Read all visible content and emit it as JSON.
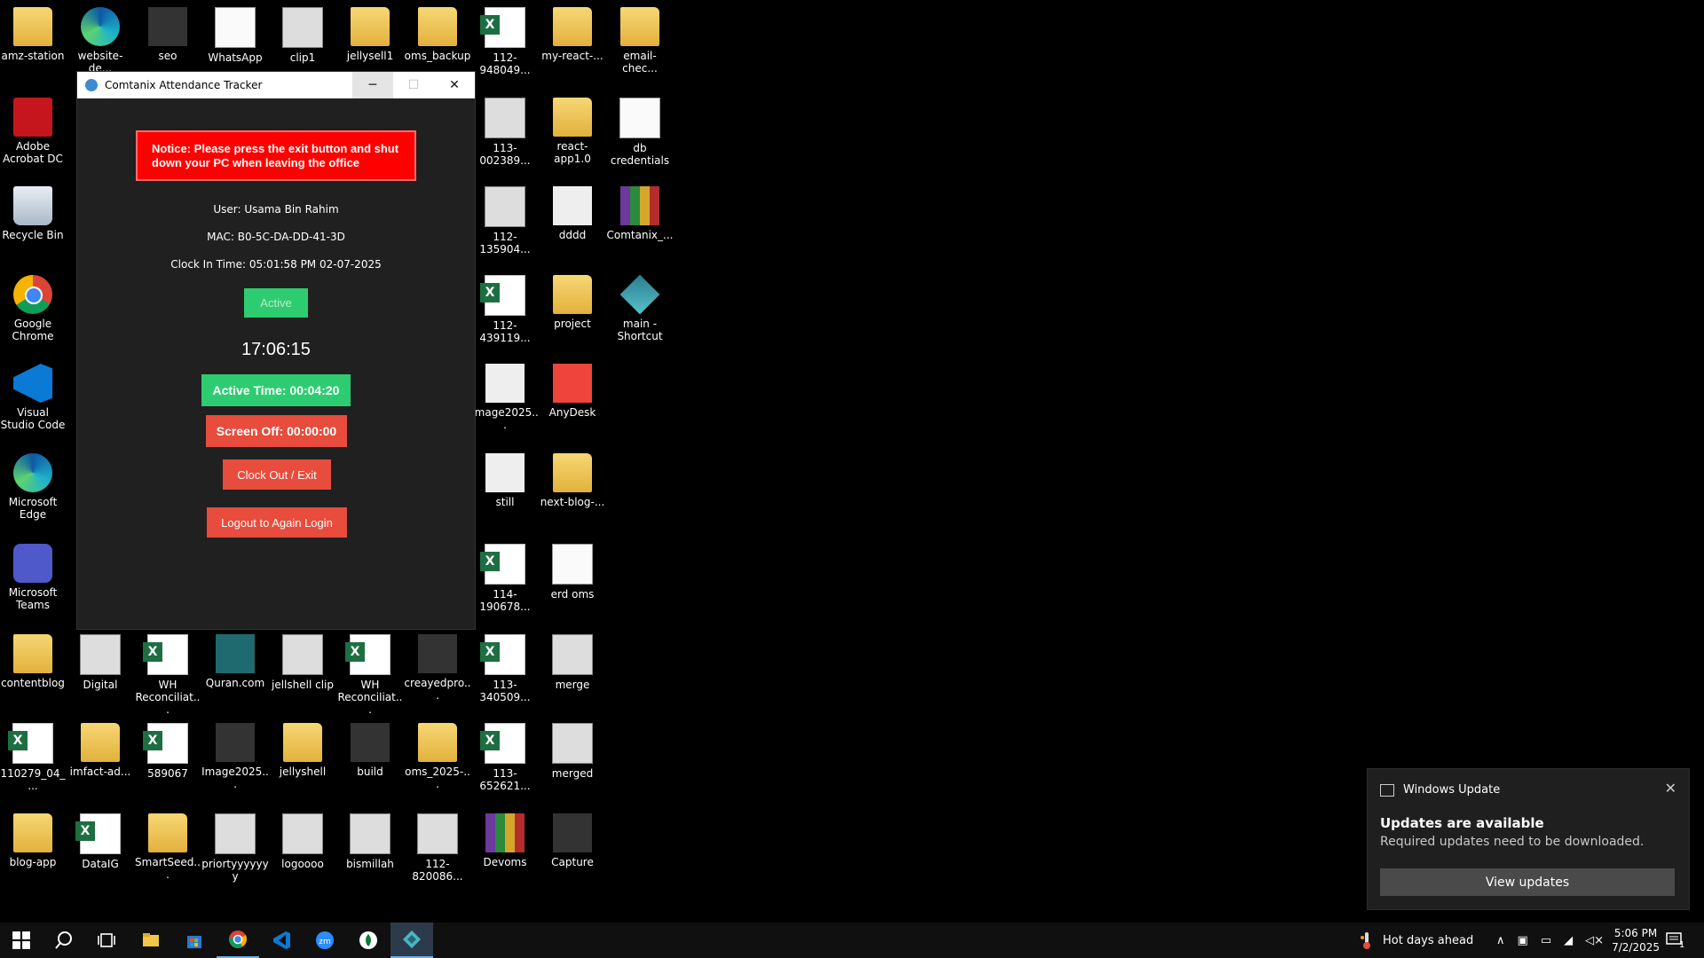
{
  "desktop": {
    "icons": [
      {
        "label": "amz-station"
      },
      {
        "label": "website-de..."
      },
      {
        "label": "seo"
      },
      {
        "label": "WhatsApp"
      },
      {
        "label": "clip1"
      },
      {
        "label": "jellysell1"
      },
      {
        "label": "oms_backup"
      },
      {
        "label": "112-948049..."
      },
      {
        "label": "my-react-..."
      },
      {
        "label": "email-chec..."
      },
      {
        "label": "Adobe Acrobat DC"
      },
      {
        "label": "113-002389..."
      },
      {
        "label": "react-app1.0"
      },
      {
        "label": "db credentials"
      },
      {
        "label": "Recycle Bin"
      },
      {
        "label": "112-135904..."
      },
      {
        "label": "dddd"
      },
      {
        "label": "Comtanix_..."
      },
      {
        "label": "Google Chrome"
      },
      {
        "label": "112-439119..."
      },
      {
        "label": "project"
      },
      {
        "label": "main - Shortcut"
      },
      {
        "label": "Visual Studio Code"
      },
      {
        "label": "Image2025..."
      },
      {
        "label": "AnyDesk"
      },
      {
        "label": "Microsoft Edge"
      },
      {
        "label": "still"
      },
      {
        "label": "next-blog-..."
      },
      {
        "label": "Microsoft Teams"
      },
      {
        "label": "114-190678..."
      },
      {
        "label": "erd oms"
      },
      {
        "label": "contentblog"
      },
      {
        "label": "Digital"
      },
      {
        "label": "WH Reconciliat..."
      },
      {
        "label": "Quran.com"
      },
      {
        "label": "jellshell clip"
      },
      {
        "label": "WH Reconciliat..."
      },
      {
        "label": "creayedpro..."
      },
      {
        "label": "113-340509..."
      },
      {
        "label": "merge"
      },
      {
        "label": "110279_04_..."
      },
      {
        "label": "imfact-ad..."
      },
      {
        "label": "589067"
      },
      {
        "label": "Image2025..."
      },
      {
        "label": "jellyshell"
      },
      {
        "label": "build"
      },
      {
        "label": "oms_2025-..."
      },
      {
        "label": "113-652621..."
      },
      {
        "label": "merged"
      },
      {
        "label": "blog-app"
      },
      {
        "label": "DataIG"
      },
      {
        "label": "SmartSeed..."
      },
      {
        "label": "priortyyyyyyy"
      },
      {
        "label": "logoooo"
      },
      {
        "label": "bismillah"
      },
      {
        "label": "112-820086..."
      },
      {
        "label": "Devoms"
      },
      {
        "label": "Capture"
      }
    ]
  },
  "app": {
    "title": "Comtanix Attendance Tracker",
    "minimize": "─",
    "maximize": "☐",
    "close": "✕",
    "notice": "Notice: Please press the exit button and shut down your PC when leaving the office",
    "user": "User: Usama Bin Rahim",
    "mac": "MAC: B0-5C-DA-DD-41-3D",
    "clock_in": "Clock In Time: 05:01:58 PM 02-07-2025",
    "status": "Active",
    "clock": "17:06:15",
    "active_time": "Active Time: 00:04:20",
    "screen_off": "Screen Off: 00:00:00",
    "clock_out_label": "Clock Out / Exit",
    "logout_label": "Logout to Again Login"
  },
  "toast": {
    "app_name": "Windows Update",
    "title": "Updates are available",
    "body": "Required updates need to be downloaded.",
    "button": "View updates",
    "close": "✕"
  },
  "taskbar": {
    "weather": "Hot days ahead",
    "time": "5:06 PM",
    "date": "7/2/2025",
    "notification_count": "1"
  },
  "colors": {
    "accent_green": "#2ecc71",
    "accent_red": "#e74c3c",
    "notice_red": "#ff0000"
  }
}
